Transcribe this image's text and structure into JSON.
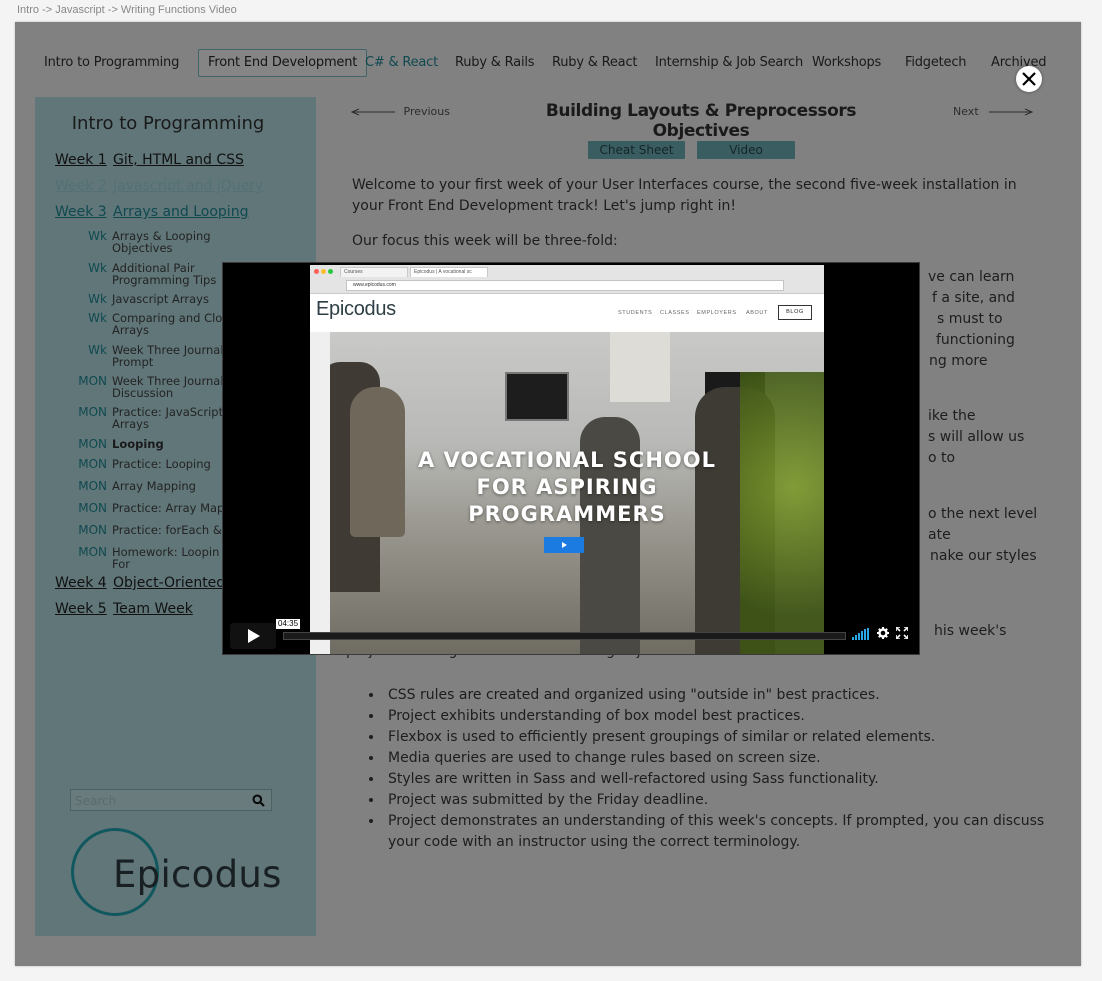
{
  "breadcrumb": "Intro -> Javascript -> Writing Functions Video",
  "top_nav": [
    {
      "label": "Intro to Programming"
    },
    {
      "label": "Front End Development"
    },
    {
      "label": "C# & React"
    },
    {
      "label": "Ruby & Rails"
    },
    {
      "label": "Ruby & React"
    },
    {
      "label": "Internship & Job Search"
    },
    {
      "label": "Workshops"
    },
    {
      "label": "Fidgetech"
    },
    {
      "label": "Archived"
    }
  ],
  "sidebar": {
    "title": "Intro to Programming",
    "weeks": [
      {
        "num": "Week 1",
        "title": "Git, HTML and CSS"
      },
      {
        "num": "Week 2",
        "title": "Javascript and jQuery"
      },
      {
        "num": "Week 3",
        "title": "Arrays and Looping"
      },
      {
        "num": "Week 4",
        "title": "Object-Oriented"
      },
      {
        "num": "Week 5",
        "title": "Team Week"
      }
    ],
    "lessons": [
      {
        "tag": "Wk",
        "text": "Arrays & Looping Objectives"
      },
      {
        "tag": "Wk",
        "text": "Additional Pair Programming Tips"
      },
      {
        "tag": "Wk",
        "text": "Javascript Arrays"
      },
      {
        "tag": "Wk",
        "text": "Comparing and Clo Arrays"
      },
      {
        "tag": "Wk",
        "text": "Week Three Journal Prompt"
      },
      {
        "tag": "MON",
        "text": "Week Three Journal Discussion"
      },
      {
        "tag": "MON",
        "text": "Practice: JavaScript Arrays"
      },
      {
        "tag": "MON",
        "text": "Looping"
      },
      {
        "tag": "MON",
        "text": "Practice: Looping"
      },
      {
        "tag": "MON",
        "text": "Array Mapping"
      },
      {
        "tag": "MON",
        "text": "Practice: Array Map"
      },
      {
        "tag": "MON",
        "text": "Practice: forEach &"
      },
      {
        "tag": "MON",
        "text": "Homework: Loopin For"
      }
    ],
    "search_placeholder": "Search",
    "logo_text": "Epicodus"
  },
  "content": {
    "previous_label": "Previous",
    "next_label": "Next",
    "title": "Building Layouts & Preprocessors Objectives",
    "tabs": [
      {
        "label": "Cheat Sheet"
      },
      {
        "label": "Video"
      }
    ],
    "intro_line1": "Welcome to your first week of your User Interfaces course, the second five-week installation in",
    "intro_line2": "your Front End Development track! Let's jump right in!",
    "focus": "Our focus this week will be three-fold:",
    "visible_fragments": [
      "ve can learn",
      "f a site, and",
      "s must to",
      "functioning",
      "ng more",
      "ike the",
      "s will allow us",
      "o to",
      "o the next level",
      "ate",
      "nake our styles",
      "his week's"
    ],
    "graded_line": "project will be graded on the following objectives:",
    "objectives": [
      "CSS rules are created and organized using \"outside in\" best practices.",
      "Project exhibits understanding of box model best practices.",
      "Flexbox is used to efficiently present groupings of similar or related elements.",
      "Media queries are used to change rules based on screen size.",
      "Styles are written in Sass and well-refactored using Sass functionality.",
      "Project was submitted by the Friday deadline.",
      "Project demonstrates an understanding of this week's concepts. If prompted, you can discuss your code with an instructor using the correct terminology."
    ]
  },
  "video": {
    "browser_tab_1": "Courses",
    "browser_tab_2": "Epicodus | A vocational sc",
    "url": "www.epicodus.com",
    "site_logo": "Epicodus",
    "site_nav": [
      "STUDENTS",
      "CLASSES",
      "EMPLOYERS",
      "ABOUT"
    ],
    "site_blog": "BLOG",
    "hero_line1": "A VOCATIONAL SCHOOL",
    "hero_line2": "FOR ASPIRING",
    "hero_line3": "PROGRAMMERS",
    "duration": "04:35",
    "progress_fraction": 0
  },
  "colors": {
    "sidebar_bg": "#b9e3e8",
    "accent_teal": "#1f8c99",
    "tab_button": "#6fb3bb",
    "overlay": "rgba(0,0,0,0.48)",
    "video_play_blue": "#1c7be0"
  }
}
